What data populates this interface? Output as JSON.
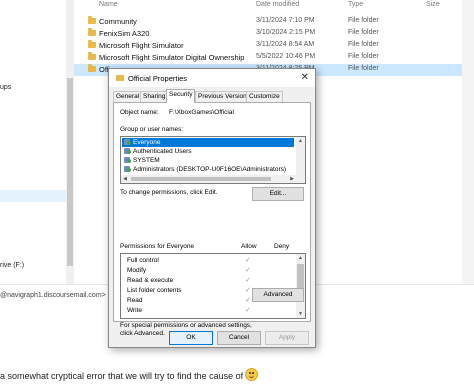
{
  "explorer": {
    "columns": {
      "name": "Name",
      "date": "Date modified",
      "type": "Type",
      "size": "Size"
    },
    "nav_items": [
      "ups",
      "rive (F:)"
    ],
    "files": [
      {
        "name": "Community",
        "date": "3/11/2024 7:10 PM",
        "type": "File folder"
      },
      {
        "name": "FenixSim A320",
        "date": "3/10/2024 2:15 PM",
        "type": "File folder"
      },
      {
        "name": "Microsoft Flight Simulator",
        "date": "3/11/2024 8:54 AM",
        "type": "File folder"
      },
      {
        "name": "Microsoft Flight Simulator Digital Ownership",
        "date": "5/5/2022 10:46 PM",
        "type": "File folder"
      },
      {
        "name": "Offi",
        "date": "3/11/2024 8:25 PM",
        "type": "File folder"
      }
    ]
  },
  "email_line": "@navigraph1.discoursemail.com>",
  "footer_text": "a somewhat cryptical error that we will try to find the cause of",
  "dialog": {
    "title": "Official Properties",
    "close_glyph": "✕",
    "tabs": [
      "General",
      "Sharing",
      "Security",
      "Previous Versions",
      "Customize"
    ],
    "active_tab": "Security",
    "object_name_label": "Object name:",
    "object_name_value": "F:\\XboxGames\\Official",
    "group_label": "Group or user names:",
    "users": [
      "Everyone",
      "Authenticated Users",
      "SYSTEM",
      "Administrators (DESKTOP-U0F16OE\\Administrators)"
    ],
    "change_text": "To change permissions, click Edit.",
    "edit_button": "Edit...",
    "permissions_label": "Permissions for Everyone",
    "allow_label": "Allow",
    "deny_label": "Deny",
    "permissions": [
      "Full control",
      "Modify",
      "Read & execute",
      "List folder contents",
      "Read",
      "Write"
    ],
    "check_glyph": "✓",
    "advanced_text_1": "For special permissions or advanced settings,",
    "advanced_text_2": "click Advanced.",
    "advanced_button": "Advanced",
    "ok_button": "OK",
    "cancel_button": "Cancel",
    "apply_button": "Apply"
  }
}
